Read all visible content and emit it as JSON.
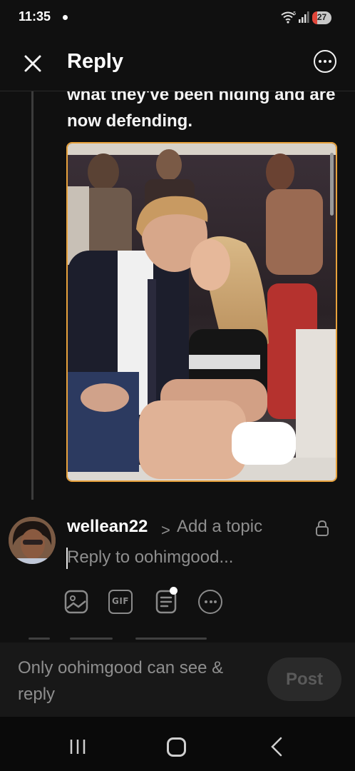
{
  "status_bar": {
    "time": "11:35",
    "wifi_badge": "5",
    "battery": "27"
  },
  "header": {
    "title": "Reply",
    "close_icon": "close-icon",
    "more_icon": "more-horizontal-icon"
  },
  "quoted_post": {
    "text": "what they've been hiding and are now defending.",
    "image_icon": "photo-thumbnail",
    "accent_color": "#e8a23c"
  },
  "composer": {
    "username": "wellean22",
    "topic_placeholder": "Add a topic",
    "reply_placeholder": "Reply to oohimgood...",
    "tools": [
      "image-icon",
      "gif-icon",
      "poll-icon",
      "more-icon"
    ],
    "gif_label": "GIF"
  },
  "footer": {
    "note": "Only oohimgood can see & reply",
    "post_label": "Post"
  },
  "colors": {
    "background": "#101010",
    "muted_text": "#8e8e8e",
    "battery_low": "#e0463a"
  }
}
